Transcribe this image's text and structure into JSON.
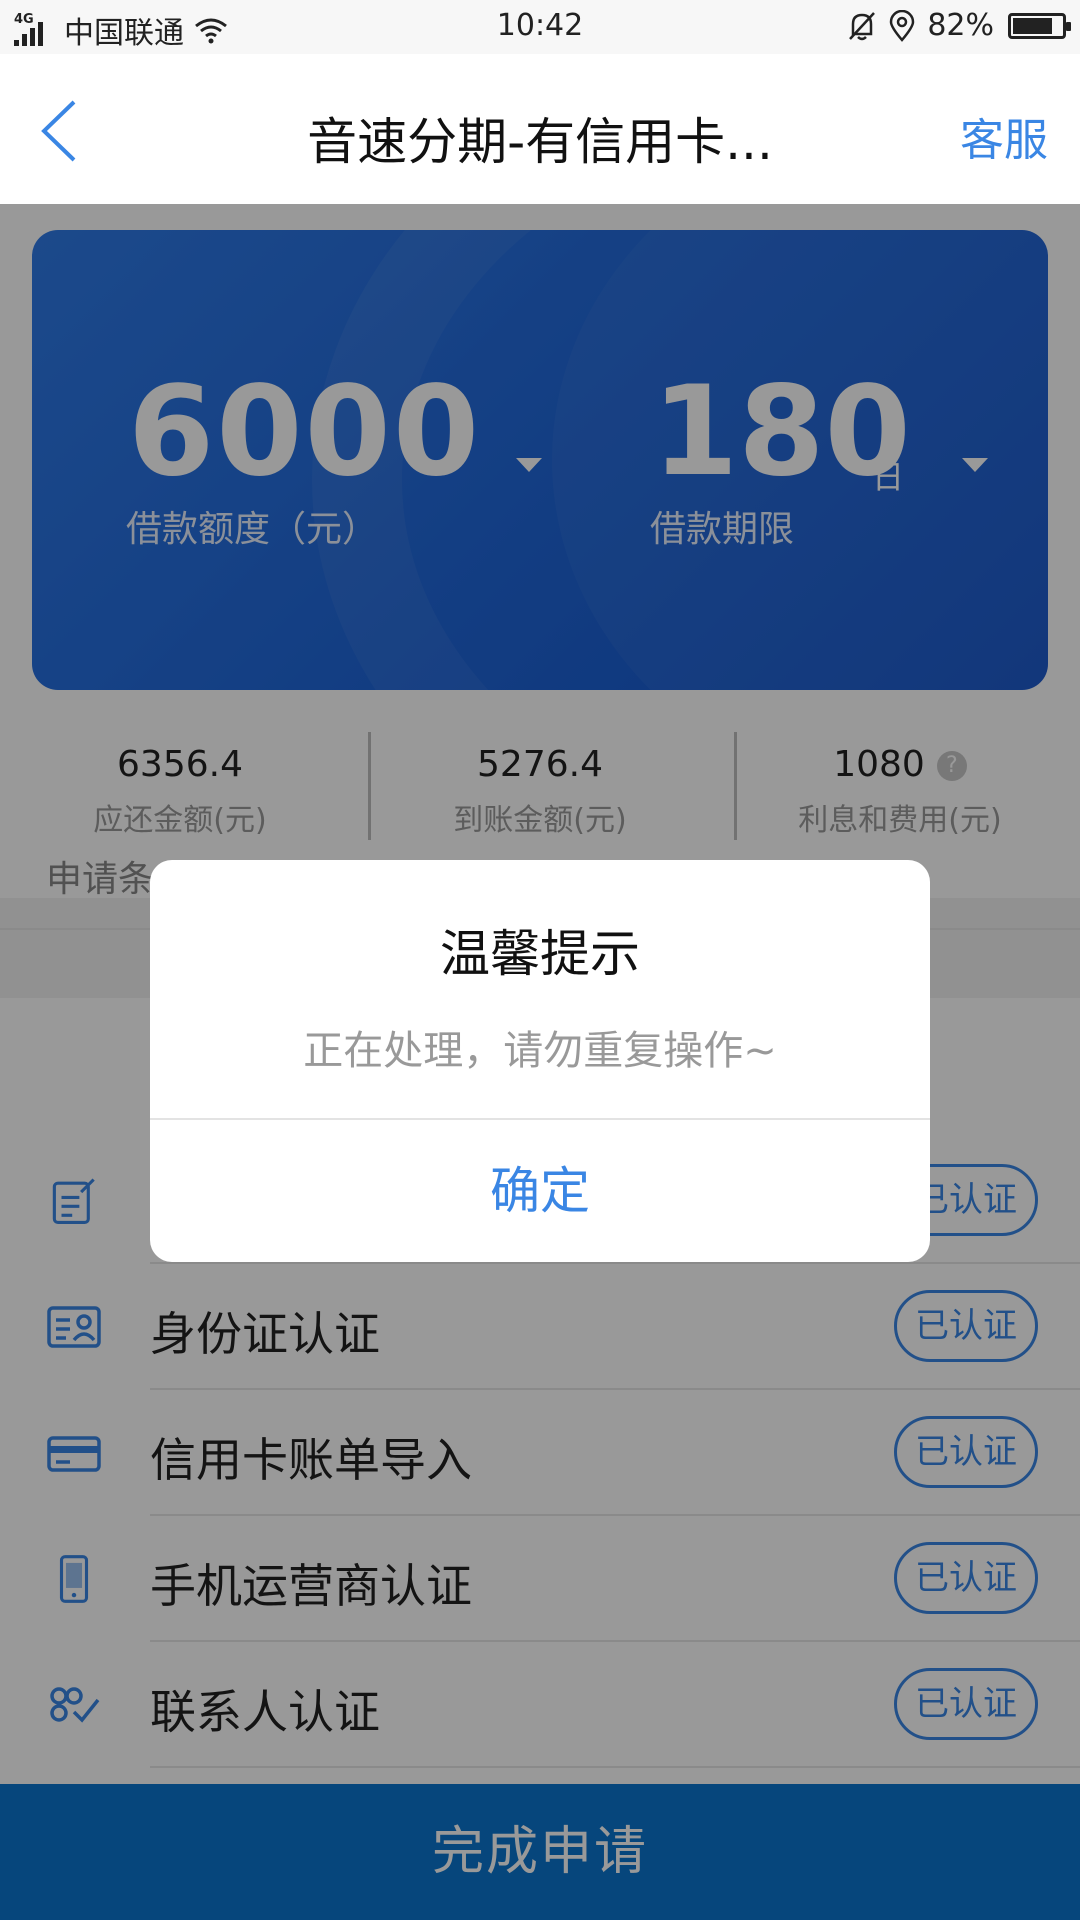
{
  "status_bar": {
    "network": "4G",
    "carrier": "中国联通",
    "time": "10:42",
    "battery": "82%",
    "battery_level": 0.82
  },
  "nav": {
    "title": "音速分期-有信用卡...",
    "service": "客服"
  },
  "loan_card": {
    "amount": "6000",
    "amount_label": "借款额度（元）",
    "term": "180",
    "term_unit": "日",
    "term_label": "借款期限"
  },
  "stats": [
    {
      "value": "6356.4",
      "label": "应还金额(元)"
    },
    {
      "value": "5276.4",
      "label": "到账金额(元)"
    },
    {
      "value": "1080",
      "label": "利息和费用(元)",
      "help_icon": "?"
    }
  ],
  "section_title": "申请条",
  "conditions": [
    {
      "label": "",
      "status": "已认证",
      "icon": "edit-document-icon"
    },
    {
      "label": "身份证认证",
      "status": "已认证",
      "icon": "id-card-icon"
    },
    {
      "label": "信用卡账单导入",
      "status": "已认证",
      "icon": "credit-card-icon"
    },
    {
      "label": "手机运营商认证",
      "status": "已认证",
      "icon": "phone-icon"
    },
    {
      "label": "联系人认证",
      "status": "已认证",
      "icon": "contacts-icon"
    }
  ],
  "submit_label": "完成申请",
  "dialog": {
    "title": "温馨提示",
    "message": "正在处理，请勿重复操作~",
    "confirm": "确定"
  },
  "colors": {
    "accent": "#3a86e4",
    "card_blue": "#1f66d9",
    "submit_blue": "#0a75cf"
  }
}
